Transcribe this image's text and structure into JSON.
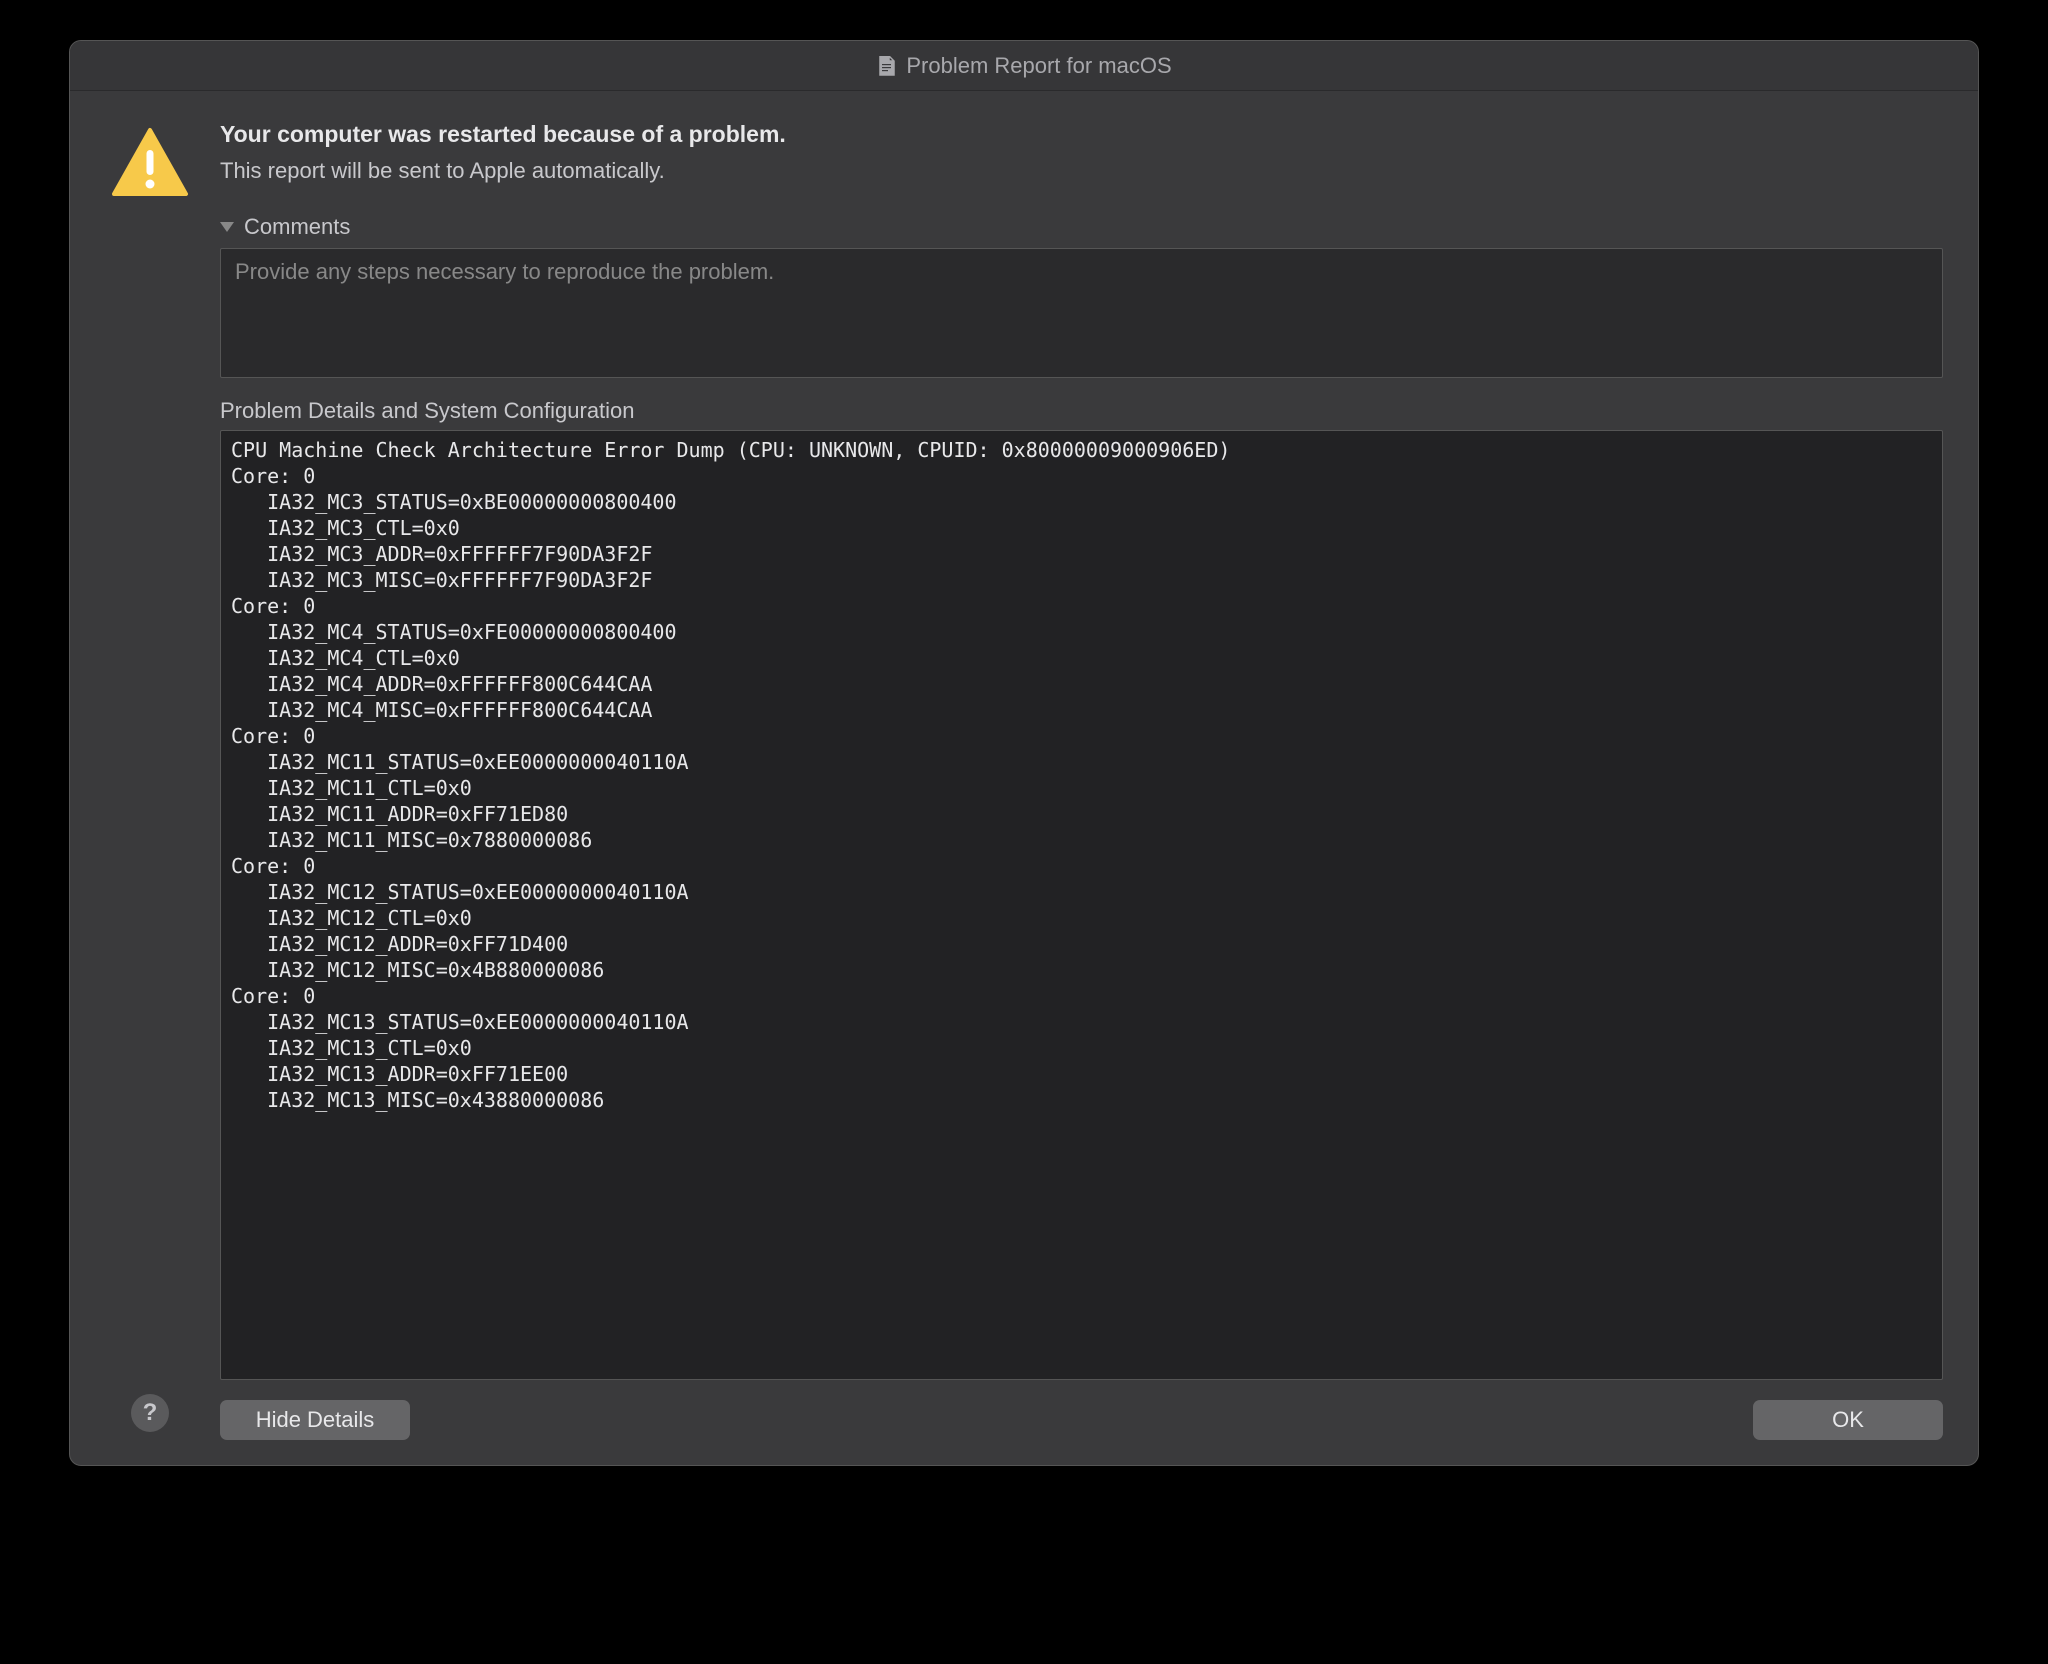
{
  "titlebar": {
    "title": "Problem Report for macOS"
  },
  "header": {
    "heading": "Your computer was restarted because of a problem.",
    "subheading": "This report will be sent to Apple automatically."
  },
  "comments": {
    "label": "Comments",
    "placeholder": "Provide any steps necessary to reproduce the problem."
  },
  "details": {
    "label": "Problem Details and System Configuration",
    "text": "CPU Machine Check Architecture Error Dump (CPU: UNKNOWN, CPUID: 0x80000009000906ED)\nCore: 0\n   IA32_MC3_STATUS=0xBE00000000800400\n   IA32_MC3_CTL=0x0\n   IA32_MC3_ADDR=0xFFFFFF7F90DA3F2F\n   IA32_MC3_MISC=0xFFFFFF7F90DA3F2F\nCore: 0\n   IA32_MC4_STATUS=0xFE00000000800400\n   IA32_MC4_CTL=0x0\n   IA32_MC4_ADDR=0xFFFFFF800C644CAA\n   IA32_MC4_MISC=0xFFFFFF800C644CAA\nCore: 0\n   IA32_MC11_STATUS=0xEE0000000040110A\n   IA32_MC11_CTL=0x0\n   IA32_MC11_ADDR=0xFF71ED80\n   IA32_MC11_MISC=0x7880000086\nCore: 0\n   IA32_MC12_STATUS=0xEE0000000040110A\n   IA32_MC12_CTL=0x0\n   IA32_MC12_ADDR=0xFF71D400\n   IA32_MC12_MISC=0x4B880000086\nCore: 0\n   IA32_MC13_STATUS=0xEE0000000040110A\n   IA32_MC13_CTL=0x0\n   IA32_MC13_ADDR=0xFF71EE00\n   IA32_MC13_MISC=0x43880000086"
  },
  "buttons": {
    "hide_details": "Hide Details",
    "ok": "OK",
    "help": "?"
  }
}
